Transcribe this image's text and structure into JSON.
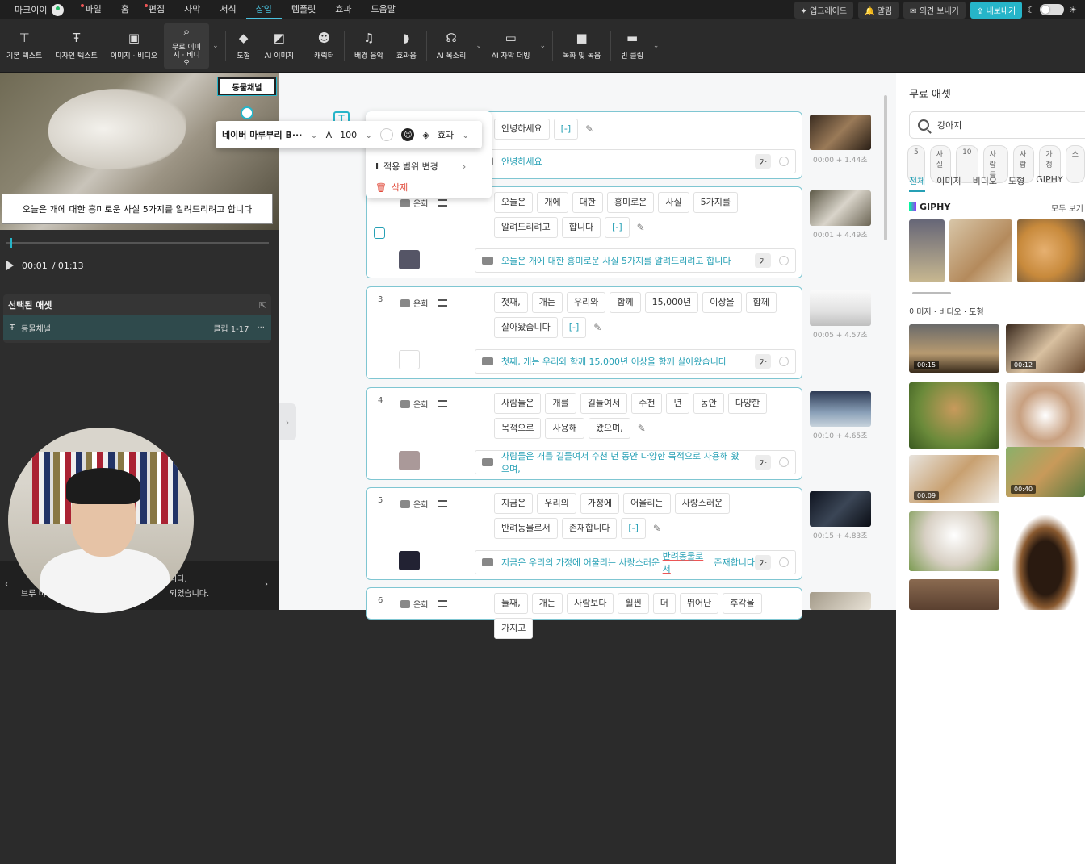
{
  "app": {
    "brand": "마크이이"
  },
  "menu": [
    "파일",
    "홈",
    "편집",
    "자막",
    "서식",
    "삽입",
    "템플릿",
    "효과",
    "도움말"
  ],
  "menu_active": "삽입",
  "topright": {
    "upgrade": "업그레이드",
    "alarm": "알림",
    "feedback": "의견 보내기",
    "export": "내보내기"
  },
  "toolbar": [
    "기본 텍스트",
    "디자인 텍스트",
    "이미지 · 비디오",
    "무료 이미지 · 비디오",
    "도형",
    "AI 이미지",
    "캐릭터",
    "배경 음악",
    "효과음",
    "AI 목소리",
    "AI 자막 더빙",
    "녹화 및 녹음",
    "빈 클립"
  ],
  "preview": {
    "subtitle": "오늘은 개에 대한 흥미로운 사실 5가지를 알려드리려고 합니다",
    "channel_label": "동물채널",
    "time_current": "00:01",
    "time_total": "/ 01:13",
    "speed": "1x"
  },
  "selected_asset": {
    "header": "선택된 애셋",
    "name": "동물채널",
    "range": "클립 1-17",
    "more": "···"
  },
  "bottom": {
    "l1": "니다.",
    "l2": "브루 비",
    "l3": "되었습니다."
  },
  "fontbar": {
    "font": "네이버 마루부리 B···",
    "size": "100",
    "effect": "효과"
  },
  "popup": {
    "item_partial": "...",
    "scope": "적용 범위 변경",
    "delete": "삭제"
  },
  "clips": [
    {
      "num": "1",
      "speaker": "",
      "words": [
        "안녕하세요",
        "[-]"
      ],
      "sentence": "안녕하세요",
      "time": "00:00 + 1.44초"
    },
    {
      "num": "2",
      "speaker": "은희",
      "words": [
        "오늘은",
        "개에",
        "대한",
        "흥미로운",
        "사실",
        "5가지를",
        "알려드리려고",
        "합니다",
        "[-]"
      ],
      "sentence": "오늘은 개에 대한 흥미로운 사실 5가지를 알려드리려고 합니다",
      "time": "00:01 + 4.49초"
    },
    {
      "num": "3",
      "speaker": "은희",
      "words": [
        "첫째,",
        "개는",
        "우리와",
        "함께",
        "15,000년",
        "이상을",
        "함께",
        "살아왔습니다",
        "[-]"
      ],
      "sentence": "첫째, 개는 우리와 함께 15,000년 이상을 함께 살아왔습니다",
      "time": "00:05 + 4.57초"
    },
    {
      "num": "4",
      "speaker": "은희",
      "words": [
        "사람들은",
        "개를",
        "길들여서",
        "수천",
        "년",
        "동안",
        "다양한",
        "목적으로",
        "사용해",
        "왔으며,"
      ],
      "sentence": "사람들은 개를 길들여서 수천 년 동안 다양한 목적으로 사용해 왔으며,",
      "time": "00:10 + 4.65초"
    },
    {
      "num": "5",
      "speaker": "은희",
      "words": [
        "지금은",
        "우리의",
        "가정에",
        "어울리는",
        "사랑스러운",
        "반려동물로서",
        "존재합니다",
        "[-]"
      ],
      "sentence_a": "지금은 우리의 가정에 어울리는 사랑스러운 ",
      "sentence_b": "반려동물로서",
      "sentence_c": " 존재합니다",
      "time": "00:15 + 4.83초"
    },
    {
      "num": "6",
      "speaker": "은희",
      "words": [
        "둘째,",
        "개는",
        "사람보다",
        "훨씬",
        "더",
        "뛰어난",
        "후각을",
        "가지고"
      ]
    }
  ],
  "right": {
    "title": "무료 애셋",
    "search_value": "강아지",
    "chips": [
      "5",
      "사실",
      "10",
      "사람들",
      "사람",
      "가정",
      "스"
    ],
    "tabs": [
      "전체",
      "이미지",
      "비디오",
      "도형",
      "GIPHY"
    ],
    "giphy": "GIPHY",
    "see_all": "모두 보기",
    "section": "이미지 · 비디오 · 도형",
    "durations": [
      "00:15",
      "00:12",
      "00:09",
      "00:40"
    ]
  },
  "colors": {
    "accent": "#26b5c9",
    "link": "#26a0b5"
  }
}
